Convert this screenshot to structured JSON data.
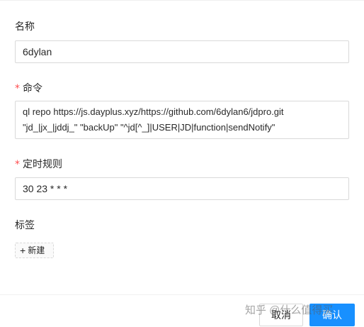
{
  "form": {
    "name": {
      "label": "名称",
      "value": "6dylan"
    },
    "command": {
      "label": "命令",
      "required_mark": "*",
      "value_line1": "ql repo https://js.dayplus.xyz/https://github.com/6dylan6/jdpro.git",
      "value_line2": "\"jd_|jx_|jddj_\" \"backUp\" \"^jd[^_]|USER|JD|function|sendNotify\""
    },
    "schedule": {
      "label": "定时规则",
      "required_mark": "*",
      "value": "30 23 * * *"
    },
    "tags": {
      "label": "标签",
      "add_label": "新建",
      "add_icon": "+"
    }
  },
  "footer": {
    "cancel_label": "取消",
    "ok_label": "确认"
  },
  "watermark": {
    "text": "知乎 @什么值得买"
  },
  "colors": {
    "primary": "#1890ff",
    "required": "#ff4d4f",
    "border": "#d9d9d9"
  }
}
